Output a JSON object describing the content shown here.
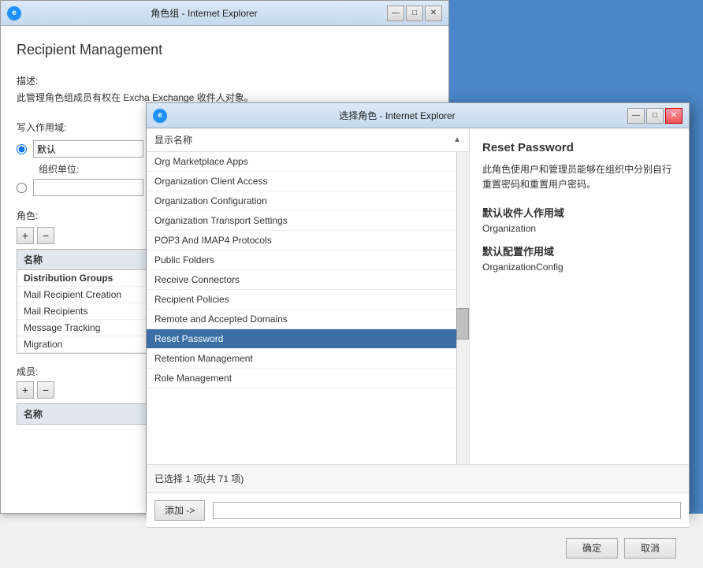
{
  "bg_window": {
    "title": "角色组 - Internet Explorer",
    "icon": "e",
    "controls": [
      "—",
      "□",
      "✕"
    ],
    "content_title": "Recipient Management",
    "desc_label": "描述:",
    "desc_text": "此管理角色组成员有权在 Excha Exchange 收件人对象。",
    "write_scope_label": "写入作用域:",
    "default_radio": "默认",
    "org_unit_label": "组织单位:",
    "roles_label": "角色:",
    "members_label": "成员:",
    "name_col": "名称",
    "roles_list": [
      {
        "label": "Distribution Groups",
        "bold": true,
        "selected": false
      },
      {
        "label": "Mail Recipient Creation",
        "bold": false,
        "selected": false
      },
      {
        "label": "Mail Recipients",
        "bold": false,
        "selected": false
      },
      {
        "label": "Message Tracking",
        "bold": false,
        "selected": false
      },
      {
        "label": "Migration",
        "bold": false,
        "selected": false
      }
    ]
  },
  "fg_dialog": {
    "title": "选择角色 - Internet Explorer",
    "icon": "e",
    "controls": [
      "—",
      "□",
      "✕"
    ],
    "col_header": "显示名称",
    "list_items": [
      {
        "label": "Org Marketplace Apps",
        "active": false
      },
      {
        "label": "Organization Client Access",
        "active": false
      },
      {
        "label": "Organization Configuration",
        "active": false
      },
      {
        "label": "Organization Transport Settings",
        "active": false
      },
      {
        "label": "POP3 And IMAP4 Protocols",
        "active": false
      },
      {
        "label": "Public Folders",
        "active": false
      },
      {
        "label": "Receive Connectors",
        "active": false
      },
      {
        "label": "Recipient Policies",
        "active": false
      },
      {
        "label": "Remote and Accepted Domains",
        "active": false
      },
      {
        "label": "Reset Password",
        "active": true
      },
      {
        "label": "Retention Management",
        "active": false
      },
      {
        "label": "Role Management",
        "active": false
      }
    ],
    "right_panel": {
      "title": "Reset Password",
      "desc": "此角色使用户和管理员能够在组织中分别自行重置密码和重置用户密码。",
      "default_recipient_scope_label": "默认收件人作用域",
      "default_recipient_scope_value": "Organization",
      "default_config_scope_label": "默认配置作用域",
      "default_config_scope_value": "OrganizationConfig"
    },
    "status_bar": "已选择 1 项(共 71 项)",
    "add_button": "添加 ->",
    "add_input_placeholder": "",
    "confirm_button": "确定",
    "cancel_button": "取消"
  }
}
